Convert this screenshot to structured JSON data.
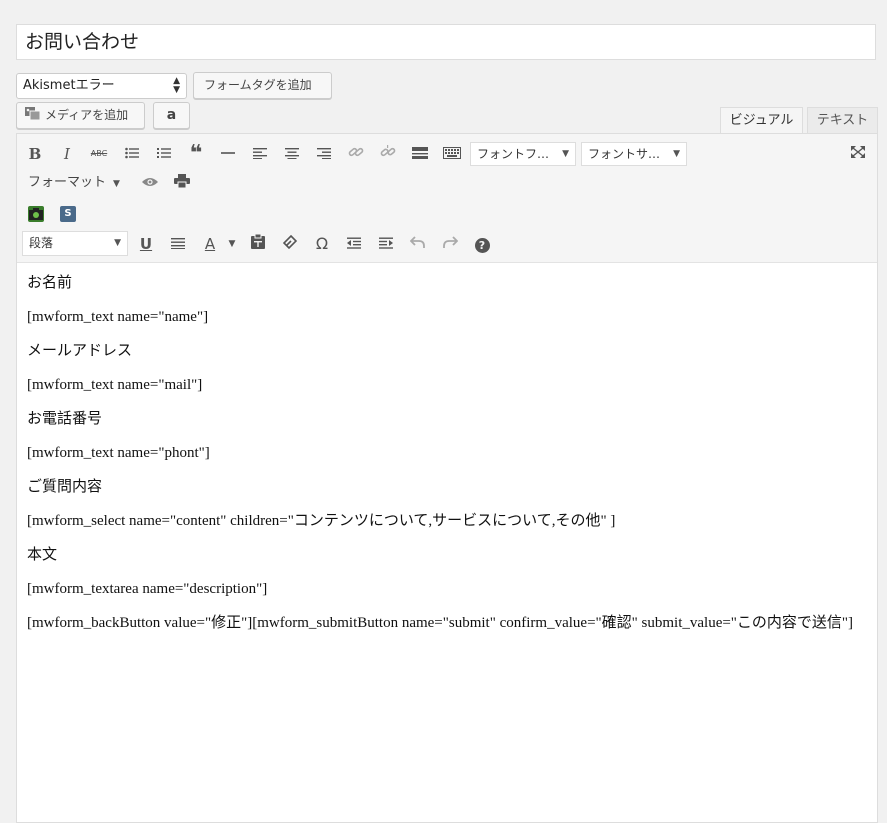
{
  "post_title": "お問い合わせ",
  "akismet_select": {
    "selected": "Akismetエラー"
  },
  "buttons": {
    "add_form_tag": "フォームタグを追加",
    "add_media": "メディアを追加",
    "amazon": "a"
  },
  "tabs": {
    "visual": "ビジュアル",
    "text": "テキスト"
  },
  "toolbar": {
    "font_family": "フォントフ…",
    "font_size": "フォントサ…",
    "format": "フォーマット",
    "paragraph": "段落",
    "bold": "B",
    "italic": "I",
    "strike": "ABC",
    "blockquote": "❝",
    "textcolor": "A",
    "omega": "Ω",
    "help": "?",
    "plugin_s": "S"
  },
  "content_lines": [
    "お名前",
    "[mwform_text name=\"name\"]",
    "メールアドレス",
    "[mwform_text name=\"mail\"]",
    "お電話番号",
    "[mwform_text name=\"phont\"]",
    "ご質問内容",
    "[mwform_select name=\"content\" children=\"コンテンツについて,サービスについて,その他\" ]",
    "本文",
    "[mwform_textarea name=\"description\"]",
    "[mwform_backButton value=\"修正\"][mwform_submitButton name=\"submit\" confirm_value=\"確認\" submit_value=\"この内容で送信\"]"
  ],
  "colors": {
    "background": "#f1f1f1",
    "toolbar": "#f5f5f5",
    "border": "#dddddd"
  }
}
